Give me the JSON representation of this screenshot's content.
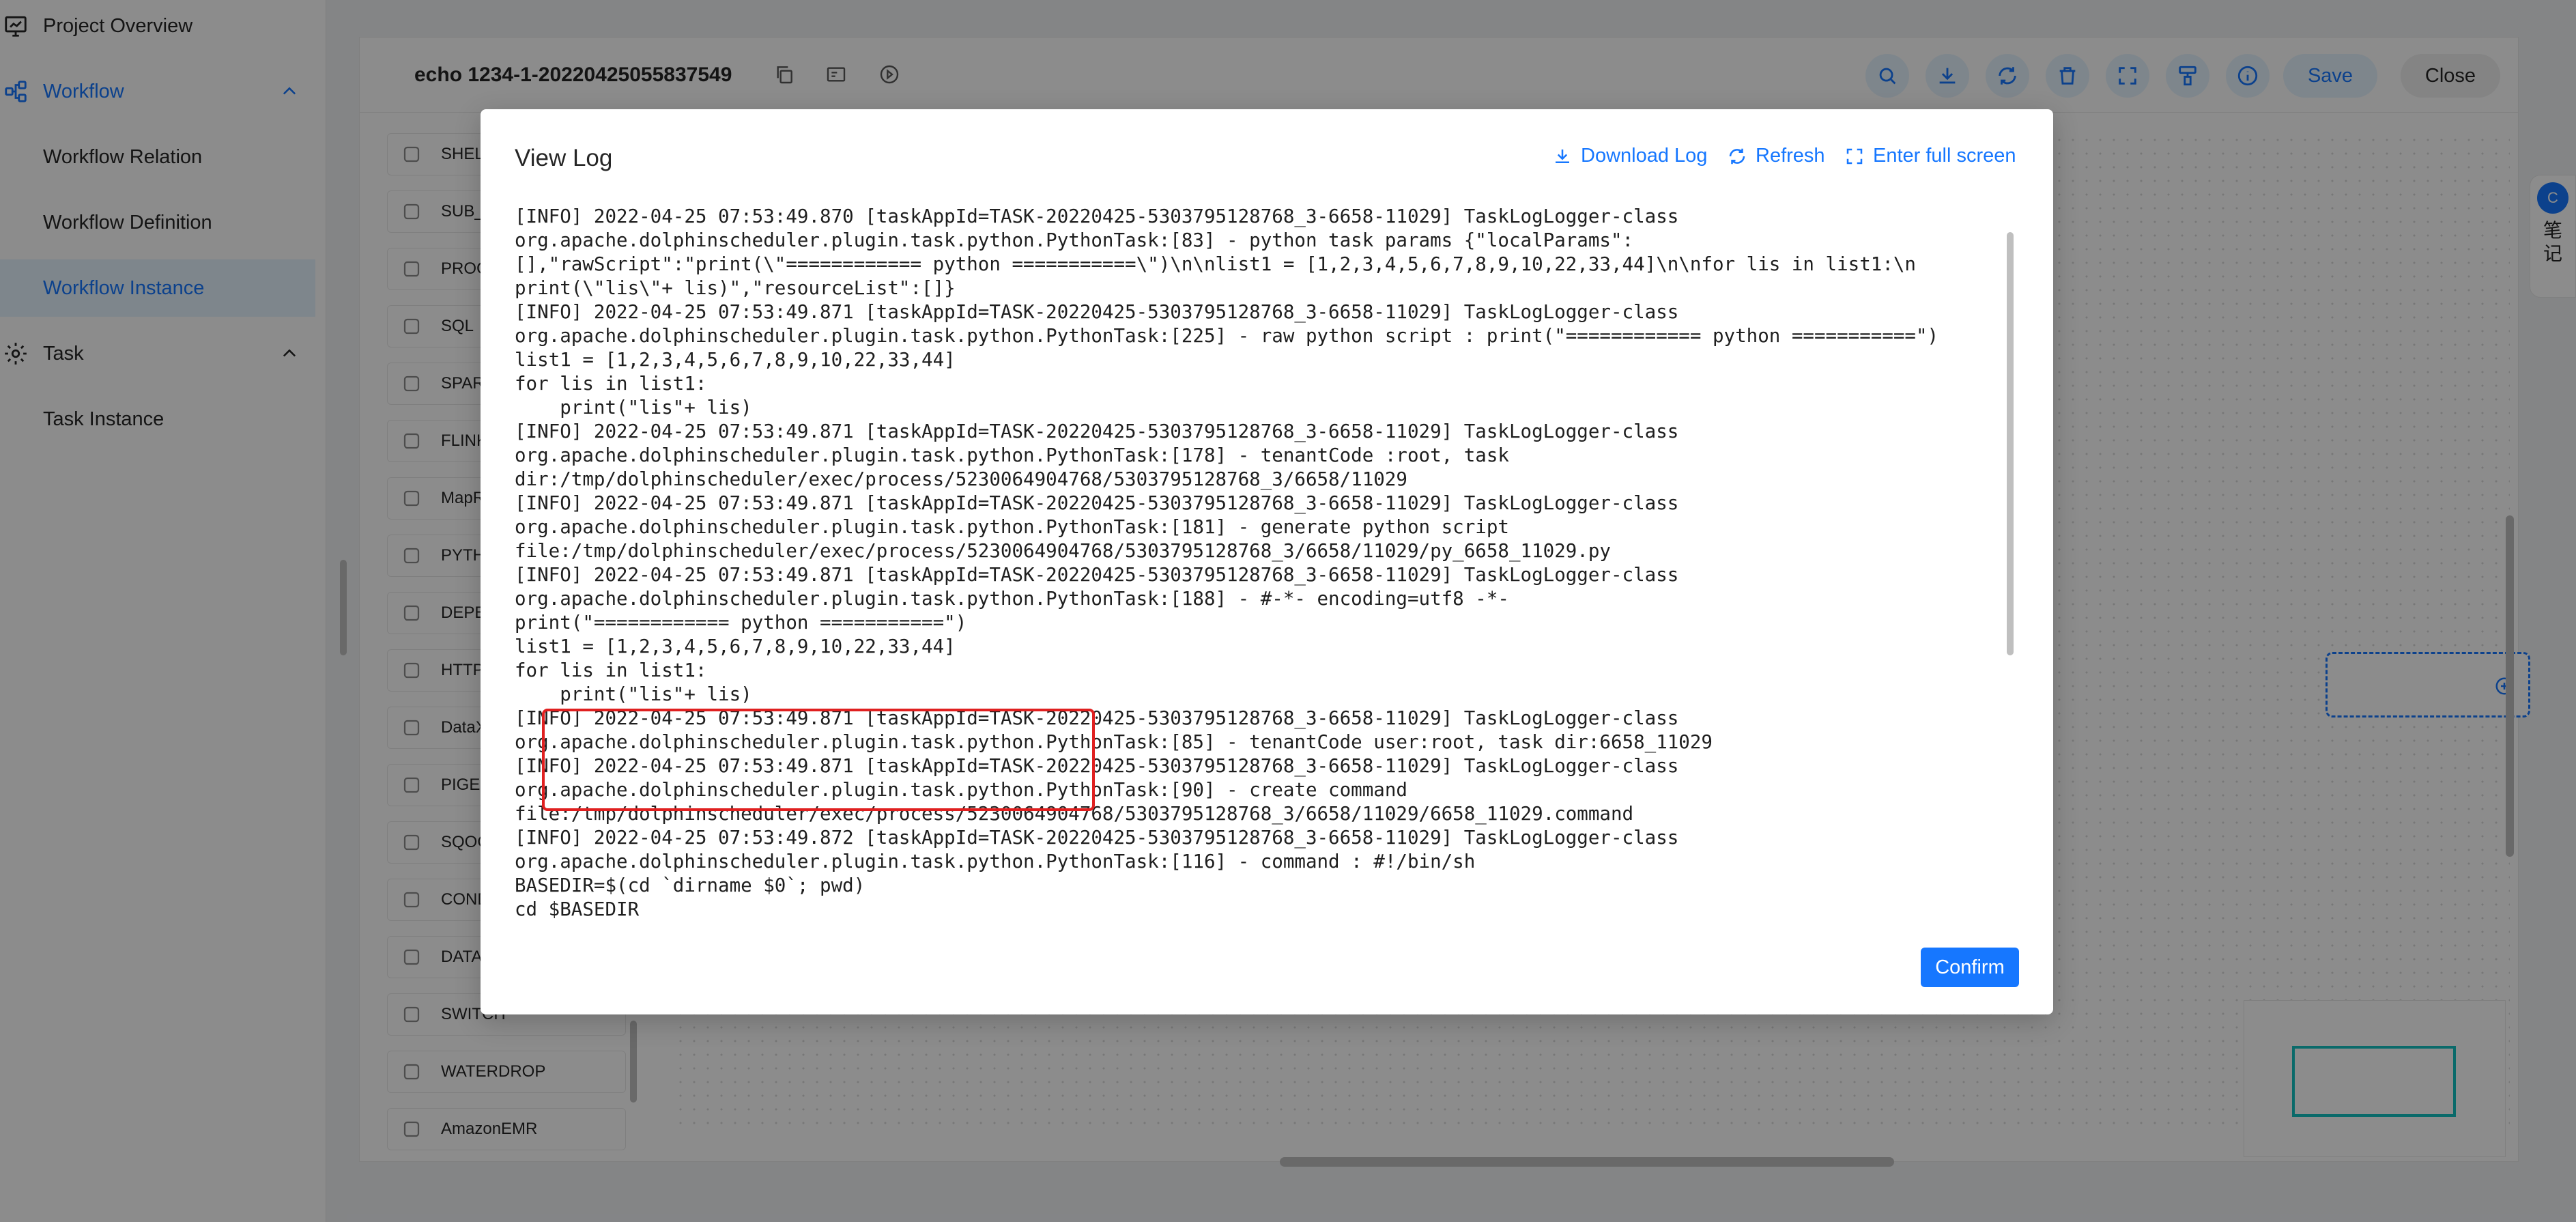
{
  "sidebar": {
    "items": [
      {
        "label": "Project Overview",
        "icon": "chart-monitor-icon"
      },
      {
        "label": "Workflow",
        "icon": "workflow-icon",
        "expanded": true
      },
      {
        "label": "Workflow Relation"
      },
      {
        "label": "Workflow Definition"
      },
      {
        "label": "Workflow Instance",
        "active": true
      },
      {
        "label": "Task",
        "icon": "gear-icon",
        "expanded": true
      },
      {
        "label": "Task Instance"
      }
    ]
  },
  "toolbar": {
    "title": "echo 1234-1-20220425055837549",
    "save_label": "Save",
    "close_label": "Close"
  },
  "palette": {
    "items": [
      "SHELL",
      "SUB_",
      "PROC",
      "SQL",
      "SPAR",
      "FLINK",
      "MapR",
      "PYTH",
      "DEPE",
      "HTTP",
      "DataX",
      "PIGE",
      "SQOO",
      "COND",
      "DATA",
      "SWITCH",
      "WATERDROP",
      "AmazonEMR"
    ]
  },
  "note_widget": {
    "badge": "C",
    "text": "笔\n记"
  },
  "modal": {
    "title": "View Log",
    "download_label": "Download Log",
    "refresh_label": "Refresh",
    "fullscreen_label": "Enter full screen",
    "confirm_label": "Confirm",
    "log_text": "[INFO] 2022-04-25 07:53:49.870 [taskAppId=TASK-20220425-5303795128768_3-6658-11029] TaskLogLogger-class\norg.apache.dolphinscheduler.plugin.task.python.PythonTask:[83] - python task params {\"localParams\":\n[],\"rawScript\":\"print(\\\"============ python ===========\\\")\\n\\nlist1 = [1,2,3,4,5,6,7,8,9,10,22,33,44]\\n\\nfor lis in list1:\\n\nprint(\\\"lis\\\"+ lis)\",\"resourceList\":[]}\n[INFO] 2022-04-25 07:53:49.871 [taskAppId=TASK-20220425-5303795128768_3-6658-11029] TaskLogLogger-class\norg.apache.dolphinscheduler.plugin.task.python.PythonTask:[225] - raw python script : print(\"============ python ===========\")\nlist1 = [1,2,3,4,5,6,7,8,9,10,22,33,44]\nfor lis in list1:\n    print(\"lis\"+ lis)\n[INFO] 2022-04-25 07:53:49.871 [taskAppId=TASK-20220425-5303795128768_3-6658-11029] TaskLogLogger-class\norg.apache.dolphinscheduler.plugin.task.python.PythonTask:[178] - tenantCode :root, task\ndir:/tmp/dolphinscheduler/exec/process/5230064904768/5303795128768_3/6658/11029\n[INFO] 2022-04-25 07:53:49.871 [taskAppId=TASK-20220425-5303795128768_3-6658-11029] TaskLogLogger-class\norg.apache.dolphinscheduler.plugin.task.python.PythonTask:[181] - generate python script\nfile:/tmp/dolphinscheduler/exec/process/5230064904768/5303795128768_3/6658/11029/py_6658_11029.py\n[INFO] 2022-04-25 07:53:49.871 [taskAppId=TASK-20220425-5303795128768_3-6658-11029] TaskLogLogger-class\norg.apache.dolphinscheduler.plugin.task.python.PythonTask:[188] - #-*- encoding=utf8 -*-\nprint(\"============ python ===========\")\nlist1 = [1,2,3,4,5,6,7,8,9,10,22,33,44]\nfor lis in list1:\n    print(\"lis\"+ lis)\n[INFO] 2022-04-25 07:53:49.871 [taskAppId=TASK-20220425-5303795128768_3-6658-11029] TaskLogLogger-class\norg.apache.dolphinscheduler.plugin.task.python.PythonTask:[85] - tenantCode user:root, task dir:6658_11029\n[INFO] 2022-04-25 07:53:49.871 [taskAppId=TASK-20220425-5303795128768_3-6658-11029] TaskLogLogger-class\norg.apache.dolphinscheduler.plugin.task.python.PythonTask:[90] - create command\nfile:/tmp/dolphinscheduler/exec/process/5230064904768/5303795128768_3/6658/11029/6658_11029.command\n[INFO] 2022-04-25 07:53:49.872 [taskAppId=TASK-20220425-5303795128768_3-6658-11029] TaskLogLogger-class\norg.apache.dolphinscheduler.plugin.task.python.PythonTask:[116] - command : #!/bin/sh\nBASEDIR=$(cd `dirname $0`; pwd)\ncd $BASEDIR"
  },
  "colors": {
    "accent": "#1677ff",
    "highlight": "#e02020",
    "minimap": "#13c2c2"
  }
}
